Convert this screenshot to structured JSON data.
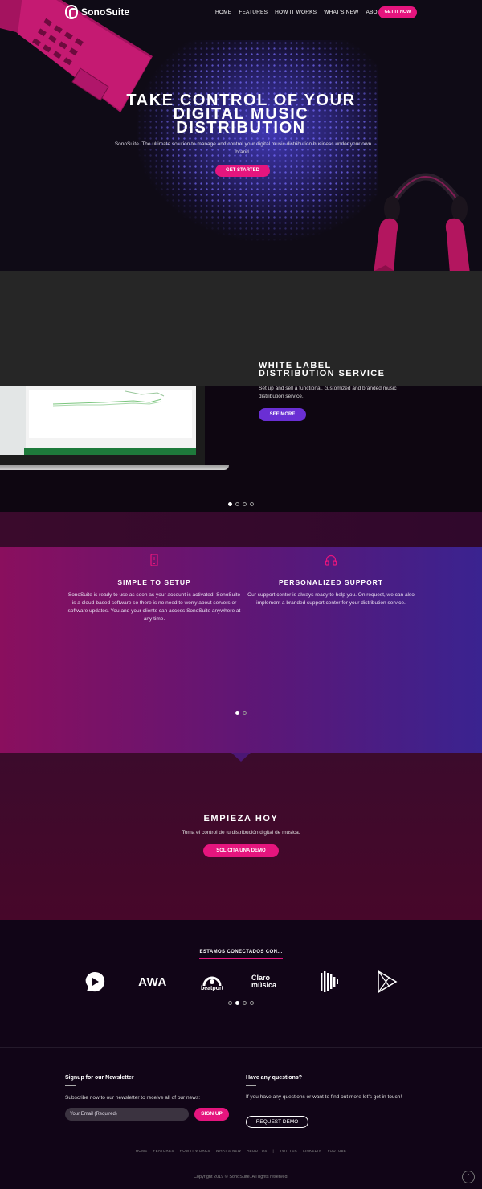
{
  "brand": {
    "name": "SonoSuite",
    "accent": "#e5157e",
    "purple": "#6a2fd4"
  },
  "nav": {
    "items": [
      "HOME",
      "FEATURES",
      "HOW IT WORKS",
      "WHAT'S NEW",
      "ABOUT US"
    ],
    "cta": "GET IT NOW"
  },
  "hero": {
    "title_lines": [
      "TAKE CONTROL OF YOUR",
      "DIGITAL MUSIC",
      "DISTRIBUTION"
    ],
    "subtitle": "SonoSuite. The ultimate solution to manage and control your digital music distribution business under your own brand.",
    "cta": "GET STARTED"
  },
  "white_label": {
    "title_lines": [
      "WHITE LABEL",
      "DISTRIBUTION SERVICE"
    ],
    "text": "Set up and sell a functional, customized and branded music distribution service.",
    "cta": "SEE MORE",
    "slide_count": 4,
    "active_slide": 1
  },
  "features": {
    "items": [
      {
        "icon": "mobile-phone-icon",
        "title": "SIMPLE TO SETUP",
        "text": "SonoSuite is ready to use as soon as your account is activated. SonoSuite is a cloud-based software so there is no need to worry about servers or software updates. You and your clients can access SonoSuite anywhere at any time."
      },
      {
        "icon": "headphones-icon",
        "title": "PERSONALIZED SUPPORT",
        "text": "Our support center is always ready to help you. On request, we can also implement a branded support center for your distribution service."
      }
    ],
    "slide_count": 2,
    "active_slide": 1
  },
  "empieza": {
    "title": "EMPIEZA HOY",
    "subtitle": "Toma el control de tu distribución digital de música.",
    "cta": "SOLICITA UNA DEMO"
  },
  "partners": {
    "title": "ESTAMOS CONECTADOS CON...",
    "logos": [
      {
        "name": "audiomack-logo",
        "label": ""
      },
      {
        "name": "awa-logo",
        "label": "AWA"
      },
      {
        "name": "beatport-logo",
        "label": "beatport"
      },
      {
        "name": "claro-musica-logo",
        "label": "Claro música"
      },
      {
        "name": "sound-logo",
        "label": ""
      },
      {
        "name": "google-play-logo",
        "label": ""
      }
    ],
    "slide_count": 4,
    "active_slide": 2
  },
  "footer": {
    "newsletter": {
      "title": "Signup for our Newsletter",
      "text": "Subscribe now to our newsletter to receive all of our news:",
      "email_placeholder": "Your Email (Required)",
      "button": "SIGN UP"
    },
    "questions": {
      "title": "Have any questions?",
      "text": "If you have any questions or want to find out more let's get in touch!",
      "button": "REQUEST DEMO"
    },
    "links": [
      "HOME",
      "FEATURES",
      "HOW IT WORKS",
      "WHAT'S NEW",
      "ABOUT US",
      "|",
      "TWITTER",
      "LINKEDIN",
      "YOUTUBE"
    ],
    "copyright": "Copyright 2019 © SonoSuite. All rights reserved.",
    "to_top_icon": "arrow-up-icon"
  }
}
